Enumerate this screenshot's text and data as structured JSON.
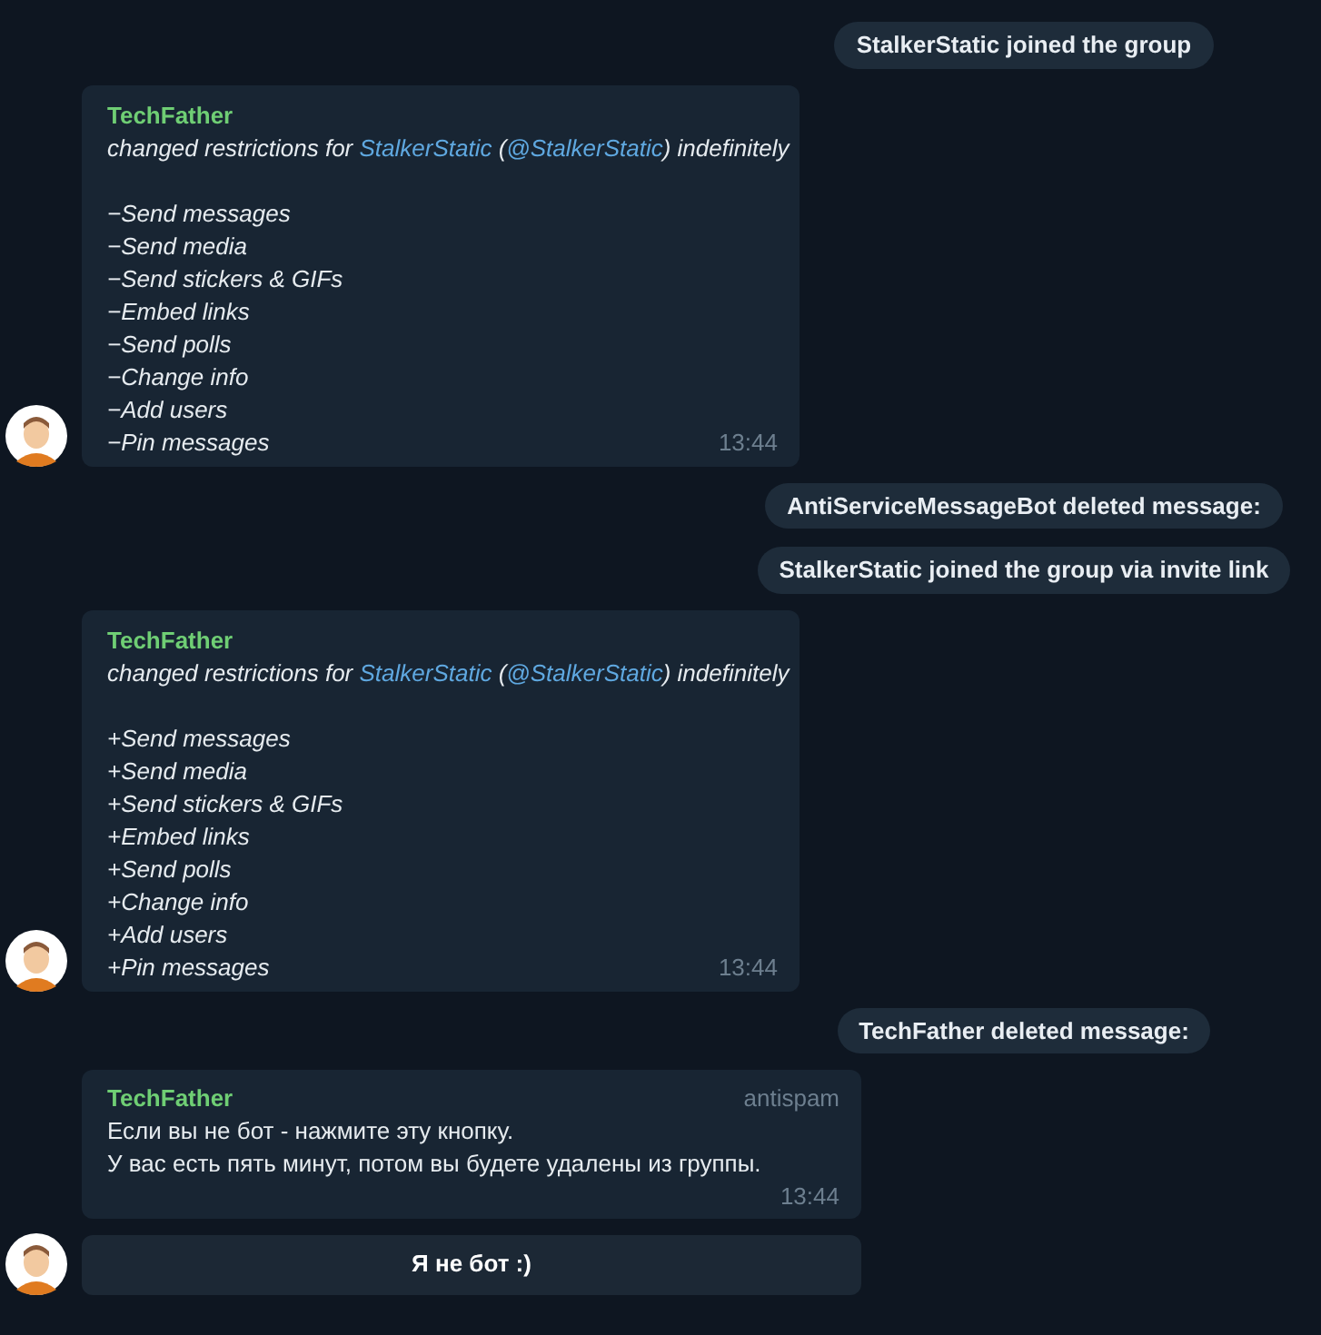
{
  "feed": [
    {
      "kind": "service",
      "text": "StalkerStatic joined the group"
    },
    {
      "kind": "restrictions",
      "author": "TechFather",
      "action": [
        {
          "kind": "text",
          "text": "changed restrictions for "
        },
        {
          "kind": "link",
          "text": "StalkerStatic"
        },
        {
          "kind": "text",
          "text": " ("
        },
        {
          "kind": "link",
          "text": "@StalkerStatic"
        },
        {
          "kind": "text",
          "text": ") indefinitely"
        }
      ],
      "lines": [
        "−Send messages",
        "−Send media",
        "−Send stickers & GIFs",
        "−Embed links",
        "−Send polls",
        "−Change info",
        "−Add users",
        "−Pin messages"
      ],
      "time": "13:44"
    },
    {
      "kind": "service",
      "text": "AntiServiceMessageBot deleted message:"
    },
    {
      "kind": "service",
      "text": "StalkerStatic joined the group via invite link"
    },
    {
      "kind": "restrictions",
      "author": "TechFather",
      "action": [
        {
          "kind": "text",
          "text": "changed restrictions for "
        },
        {
          "kind": "link",
          "text": "StalkerStatic"
        },
        {
          "kind": "text",
          "text": " ("
        },
        {
          "kind": "link",
          "text": "@StalkerStatic"
        },
        {
          "kind": "text",
          "text": ") indefinitely"
        }
      ],
      "lines": [
        "+Send messages",
        "+Send media",
        "+Send stickers & GIFs",
        "+Embed links",
        "+Send polls",
        "+Change info",
        "+Add users",
        "+Pin messages"
      ],
      "time": "13:44"
    },
    {
      "kind": "service",
      "text": "TechFather deleted message:"
    },
    {
      "kind": "bot",
      "author": "TechFather",
      "badge": "antispam",
      "lines": [
        "Если вы не бот - нажмите эту кнопку.",
        "У вас есть пять минут, потом вы будете удалены из группы."
      ],
      "time": "13:44",
      "button": "Я не бот :)"
    }
  ]
}
